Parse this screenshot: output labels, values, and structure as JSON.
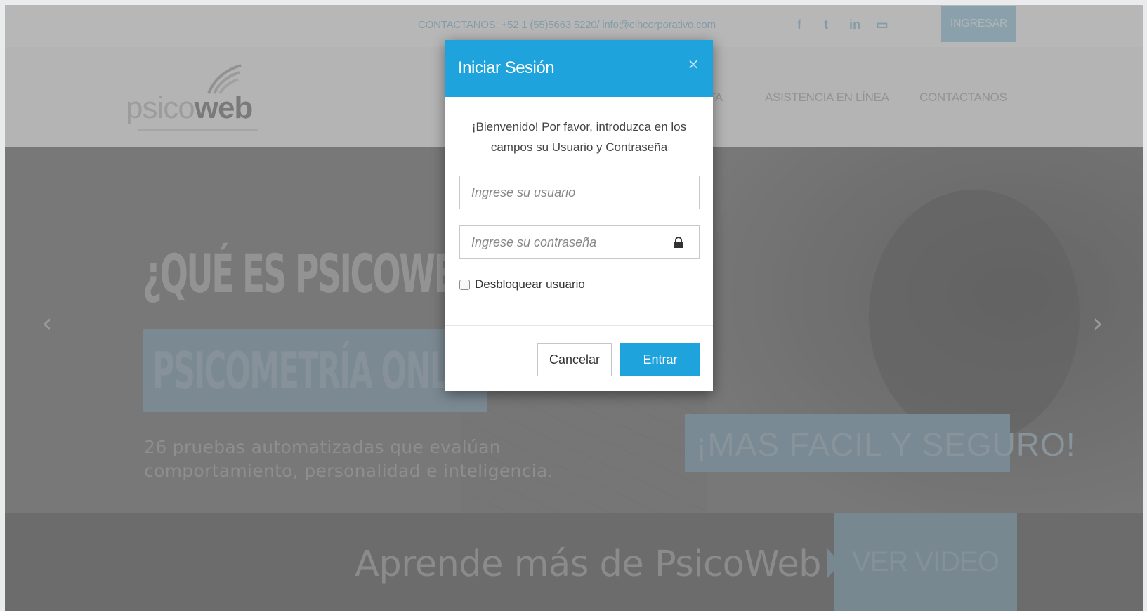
{
  "header": {
    "contact": "CONTACTANOS: +52 1 (55)5663 5220/ info@elhcorporativo.com",
    "social": {
      "facebook": "f",
      "twitter": "t",
      "linkedin": "in",
      "youtube": "▭"
    },
    "login_button": "INGRESAR",
    "logo": {
      "part1": "psico",
      "part2": "web"
    },
    "nav": {
      "item1": "NTA",
      "item2": "ASISTENCIA EN LÍNEA",
      "item3": "CONTACTANOS"
    }
  },
  "hero": {
    "title": "¿QUÉ ES PSICOWEB?",
    "subtitle": "PSICOMETRÍA ONLINE",
    "description": "26 pruebas automatizadas que evalúan comportamiento, personalidad e inteligencia.",
    "badge": "¡MAS FACIL Y SEGURO!",
    "prev_arrow": "‹",
    "next_arrow": "›"
  },
  "band": {
    "text": "Aprende más de PsicoWeb",
    "video_button": "VER VIDEO"
  },
  "modal": {
    "title": "Iniciar Sesión",
    "close": "×",
    "welcome": "¡Bienvenido! Por favor, introduzca en los campos su Usuario y Contraseña",
    "user_placeholder": "Ingrese su usuario",
    "password_placeholder": "Ingrese su contraseña",
    "unlock_label": "Desbloquear usuario",
    "cancel_label": "Cancelar",
    "enter_label": "Entrar"
  },
  "colors": {
    "accent": "#1ea3dd",
    "overlay": "#7a7a7a"
  }
}
